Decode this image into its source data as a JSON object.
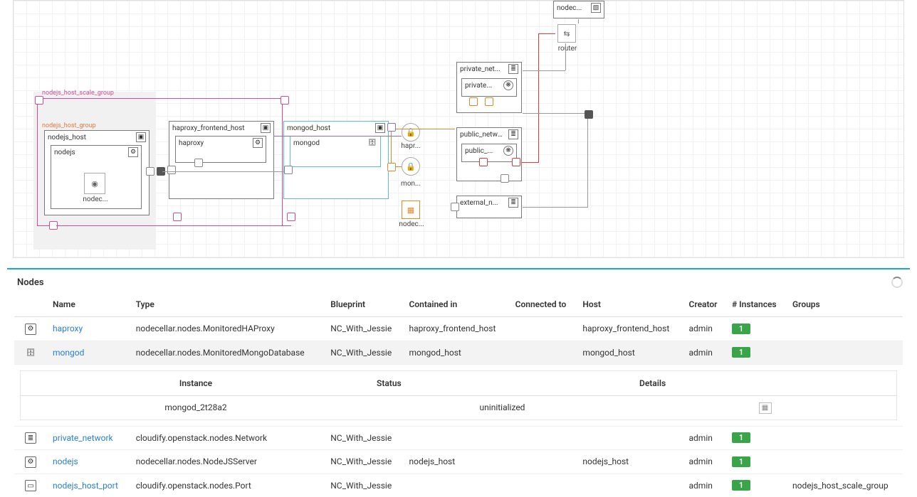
{
  "topology": {
    "groups": {
      "scale_group": {
        "label": "nodejs_host_scale_group"
      },
      "aux_group": {
        "label": "nodejs_host_group"
      }
    },
    "nodes": {
      "nodec_top": {
        "label": "nodec..."
      },
      "router": {
        "label": "router"
      },
      "private_net": {
        "label": "private_net..."
      },
      "private_child": {
        "label": "private..."
      },
      "public_network": {
        "label": "public_network"
      },
      "public_child": {
        "label": "public_..."
      },
      "external_n": {
        "label": "external_n..."
      },
      "nodejs_host": {
        "label": "nodejs_host"
      },
      "nodejs": {
        "label": "nodejs"
      },
      "nodec_inner": {
        "label": "nodec..."
      },
      "haproxy_host": {
        "label": "haproxy_frontend_host"
      },
      "haproxy": {
        "label": "haproxy"
      },
      "mongod_host": {
        "label": "mongod_host"
      },
      "mongod": {
        "label": "mongod"
      },
      "hapr_float": {
        "label": "hapr..."
      },
      "mon_float": {
        "label": "mon..."
      },
      "nodec_float": {
        "label": "nodec..."
      }
    }
  },
  "nodes_section": {
    "title": "Nodes",
    "columns": {
      "name": "Name",
      "type": "Type",
      "blueprint": "Blueprint",
      "contained_in": "Contained in",
      "connected_to": "Connected to",
      "host": "Host",
      "creator": "Creator",
      "instances": "# Instances",
      "groups": "Groups"
    },
    "rows": {
      "haproxy": {
        "name": "haproxy",
        "type": "nodecellar.nodes.MonitoredHAProxy",
        "blueprint": "NC_With_Jessie",
        "contained_in": "haproxy_frontend_host",
        "connected_to": "",
        "host": "haproxy_frontend_host",
        "creator": "admin",
        "instances": "1",
        "groups": ""
      },
      "mongod": {
        "name": "mongod",
        "type": "nodecellar.nodes.MonitoredMongoDatabase",
        "blueprint": "NC_With_Jessie",
        "contained_in": "mongod_host",
        "connected_to": "",
        "host": "mongod_host",
        "creator": "admin",
        "instances": "1",
        "groups": ""
      },
      "private_network": {
        "name": "private_network",
        "type": "cloudify.openstack.nodes.Network",
        "blueprint": "NC_With_Jessie",
        "contained_in": "",
        "connected_to": "",
        "host": "",
        "creator": "admin",
        "instances": "1",
        "groups": ""
      },
      "nodejs": {
        "name": "nodejs",
        "type": "nodecellar.nodes.NodeJSServer",
        "blueprint": "NC_With_Jessie",
        "contained_in": "nodejs_host",
        "connected_to": "",
        "host": "nodejs_host",
        "creator": "admin",
        "instances": "1",
        "groups": ""
      },
      "nodejs_host_port": {
        "name": "nodejs_host_port",
        "type": "cloudify.openstack.nodes.Port",
        "blueprint": "NC_With_Jessie",
        "contained_in": "",
        "connected_to": "",
        "host": "",
        "creator": "admin",
        "instances": "1",
        "groups": "nodejs_host_scale_group"
      }
    },
    "instance_panel": {
      "cols": {
        "instance": "Instance",
        "status": "Status",
        "details": "Details"
      },
      "row": {
        "instance": "mongod_2t28a2",
        "status": "uninitialized"
      }
    }
  }
}
